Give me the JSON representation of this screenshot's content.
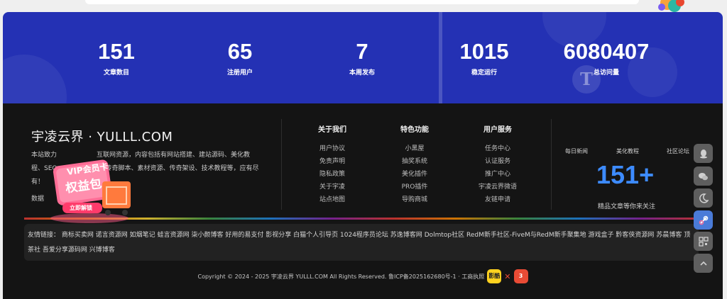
{
  "stats": [
    {
      "value": "151",
      "label": "文章数目"
    },
    {
      "value": "65",
      "label": "注册用户"
    },
    {
      "value": "7",
      "label": "本周发布"
    },
    {
      "value": "1015",
      "label": "稳定运行"
    },
    {
      "value": "6080407",
      "label": "总访问量"
    }
  ],
  "brand": {
    "title": "宇凌云界 · YULLL.COM",
    "desc_a": "本站致力",
    "desc_b": "互联网资源，内容包括有网站搭建、建站源码、美化教",
    "desc_c": "程、SEO",
    "desc_d": "传奇脚本、素材资源、传奇架设、技术教程等，应有尽",
    "desc_e": "有！",
    "desc_f": "数据"
  },
  "vip": {
    "line1": "VIP会员卡",
    "line2": "权益包",
    "cta": "立即解锁"
  },
  "columns": [
    {
      "title": "关于我们",
      "items": [
        "用户协议",
        "免责声明",
        "隐私政策",
        "关于宇凌",
        "站点地图"
      ]
    },
    {
      "title": "特色功能",
      "items": [
        "小黑屋",
        "抽奖系统",
        "美化插件",
        "PRO插件",
        "导购商城"
      ]
    },
    {
      "title": "用户服务",
      "items": [
        "任务中心",
        "认证服务",
        "推广中心",
        "宇凌云界微语",
        "友链申请"
      ]
    }
  ],
  "right_panel": {
    "tabs": [
      "每日新闻",
      "美化教程",
      "社区论坛"
    ],
    "count": "151+",
    "caption": "精品文章等你来关注"
  },
  "friend_links": {
    "label": "友情链接：",
    "items": [
      "商标买卖网",
      "诺言资源网",
      "如烟笔记",
      "蛙言资源网",
      "柒小颜博客",
      "好用的易支付",
      "影视分享",
      "白猫个人引导页",
      "1024程序员论坛",
      "苏逸博客网",
      "Dolmtop社区",
      "RedM新手社区-FiveM与RedM新手聚集地",
      "游戏盒子",
      "黔客侠资源网",
      "苏晨博客",
      "顶",
      "茶社",
      "吾爱分享源码网",
      "兴博博客"
    ]
  },
  "footer": {
    "copyright": "Copyright © 2024 - 2025 宇凌云界 YULLL.COM All Rights Reserved. 鲁ICP备2025162680号-1 · 工商执照",
    "badge1": "影酷",
    "badge2": "3",
    "x": "✕"
  },
  "side_buttons": [
    "qq-icon",
    "wechat-icon",
    "moon-icon",
    "link-icon",
    "qrcode-icon",
    "arrow-up-icon"
  ],
  "colors": {
    "stats_bg": "#2431b4",
    "footer_bg": "#141414",
    "accent_blue": "#3d8bff",
    "vip_pink": "#ff4d7d"
  }
}
